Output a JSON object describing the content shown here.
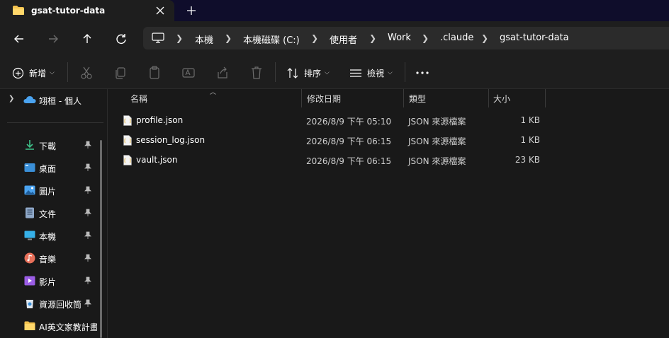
{
  "tab": {
    "title": "gsat-tutor-data"
  },
  "breadcrumb": [
    "本機",
    "本機磁碟 (C:)",
    "使用者",
    "Work",
    ".claude",
    "gsat-tutor-data"
  ],
  "toolbar": {
    "new_label": "新增",
    "sort_label": "排序",
    "view_label": "檢視"
  },
  "sidebar": {
    "onedrive_label": "翊桓 - 個人",
    "items": [
      {
        "label": "下載",
        "icon": "download-icon",
        "pinned": true
      },
      {
        "label": "桌面",
        "icon": "desktop-icon",
        "pinned": true
      },
      {
        "label": "圖片",
        "icon": "pictures-icon",
        "pinned": true
      },
      {
        "label": "文件",
        "icon": "documents-icon",
        "pinned": true
      },
      {
        "label": "本機",
        "icon": "this-pc-icon",
        "pinned": true
      },
      {
        "label": "音樂",
        "icon": "music-icon",
        "pinned": true
      },
      {
        "label": "影片",
        "icon": "videos-icon",
        "pinned": true
      },
      {
        "label": "資源回收筒",
        "icon": "recycle-bin-icon",
        "pinned": true
      },
      {
        "label": "AI英文家教計畫",
        "icon": "folder-icon",
        "pinned": false
      }
    ]
  },
  "columns": {
    "name": "名稱",
    "modified": "修改日期",
    "type": "類型",
    "size": "大小"
  },
  "files": [
    {
      "name": "profile.json",
      "modified": "2026/8/9 下午 05:10",
      "type": "JSON 來源檔案",
      "size": "1 KB"
    },
    {
      "name": "session_log.json",
      "modified": "2026/8/9 下午 06:15",
      "type": "JSON 來源檔案",
      "size": "1 KB"
    },
    {
      "name": "vault.json",
      "modified": "2026/8/9 下午 06:15",
      "type": "JSON 來源檔案",
      "size": "23 KB"
    }
  ],
  "colors": {
    "accent": "#0f0d2b",
    "folder": "#f2c14e",
    "onedrive": "#4aa3f0"
  }
}
